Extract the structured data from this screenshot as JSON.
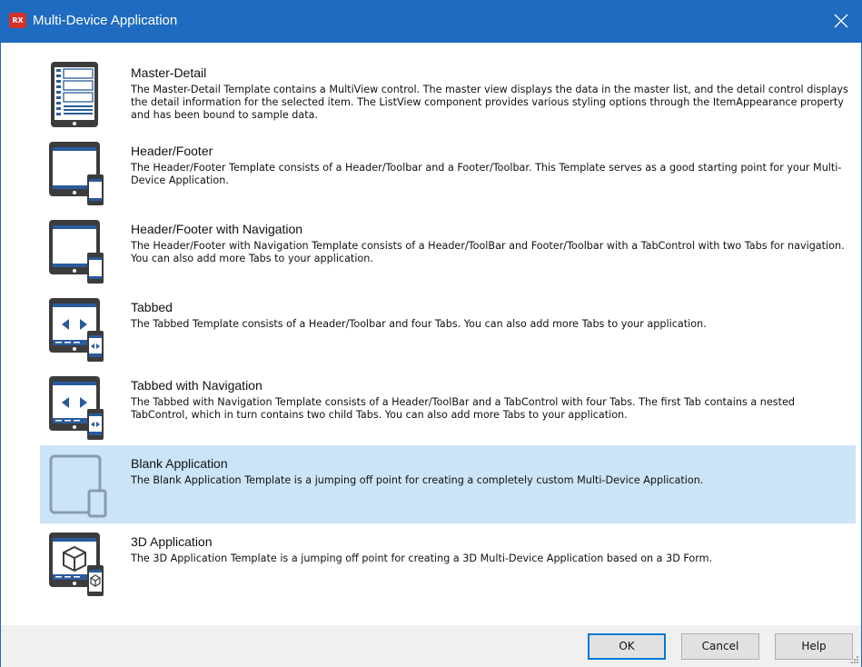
{
  "window": {
    "title": "Multi-Device Application",
    "logo_text": "RX"
  },
  "templates": [
    {
      "name": "Master-Detail",
      "description": "The Master-Detail Template contains a MultiView control. The master view displays the data in the master list, and the detail control displays the detail information for the selected item. The ListView component provides various styling options through the ItemAppearance property and has been bound to sample data.",
      "icon": "master-detail-icon",
      "selected": false
    },
    {
      "name": "Header/Footer",
      "description": "The Header/Footer Template consists of a Header/Toolbar and a Footer/Toolbar. This Template serves as a good starting point for your Multi-Device Application.",
      "icon": "header-footer-icon",
      "selected": false
    },
    {
      "name": "Header/Footer with Navigation",
      "description": "The Header/Footer with Navigation Template consists of a Header/ToolBar and Footer/Toolbar with a TabControl with two Tabs for navigation.  You can also add more Tabs to your application.",
      "icon": "header-footer-navigation-icon",
      "selected": false
    },
    {
      "name": "Tabbed",
      "description": "The Tabbed Template consists of a Header/Toolbar and four Tabs.  You can also add more Tabs to your application.",
      "icon": "tabbed-icon",
      "selected": false
    },
    {
      "name": "Tabbed with Navigation",
      "description": "The Tabbed with Navigation Template consists of a Header/ToolBar and a TabControl with four Tabs. The first Tab contains a nested TabControl, which in turn contains two child Tabs. You can also add more Tabs to your application.",
      "icon": "tabbed-navigation-icon",
      "selected": false
    },
    {
      "name": "Blank Application",
      "description": "The Blank Application Template is a jumping off point for creating a completely custom Multi-Device Application.",
      "icon": "blank-application-icon",
      "selected": true
    },
    {
      "name": "3D Application",
      "description": "The 3D Application Template is a jumping off point for creating a 3D Multi-Device Application based on a 3D Form.",
      "icon": "3d-application-icon",
      "selected": false
    }
  ],
  "buttons": {
    "ok": "OK",
    "cancel": "Cancel",
    "help": "Help"
  },
  "colors": {
    "titlebar": "#1f6bbf",
    "selection": "#cce4f7",
    "icon_blue": "#2a5b9c",
    "icon_gray": "#3c3c3c"
  }
}
